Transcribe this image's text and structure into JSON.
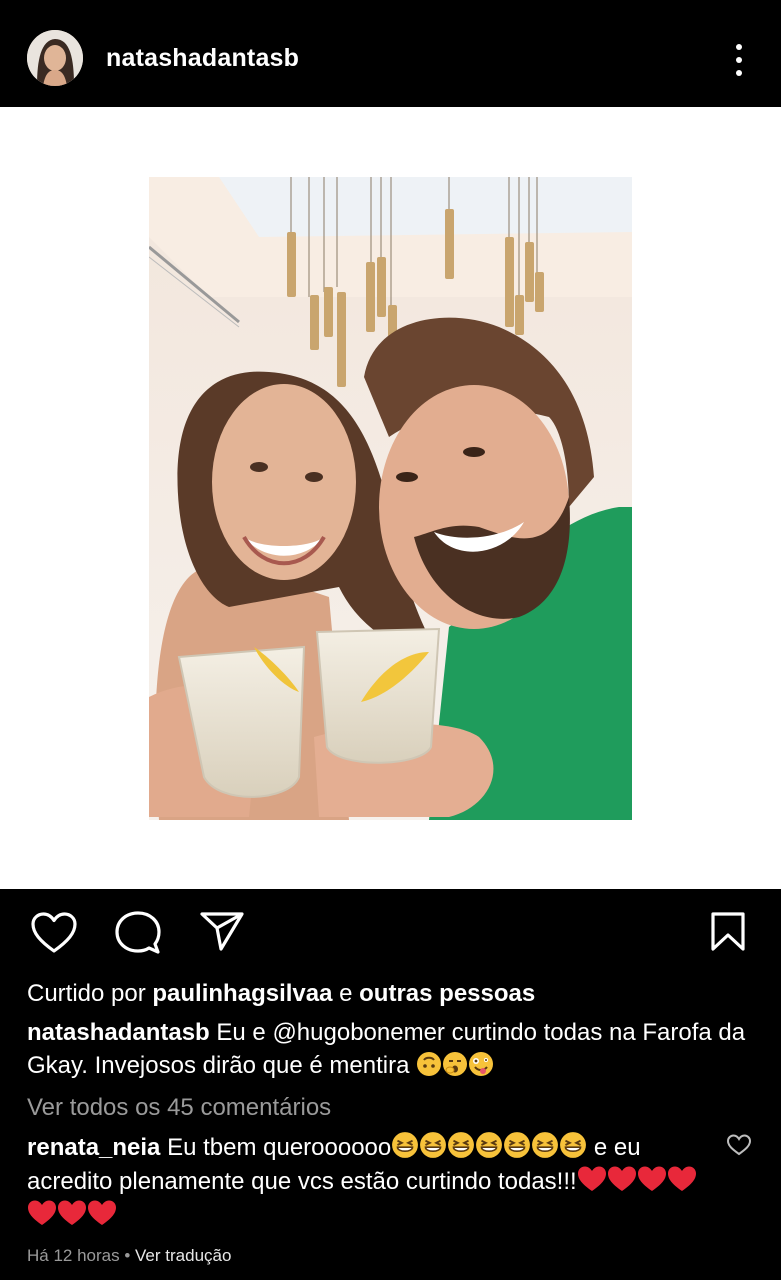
{
  "header": {
    "username": "natashadantasb"
  },
  "likes": {
    "prefix": "Curtido por ",
    "user": "paulinhagsilvaa",
    "middle": " e ",
    "others": "outras pessoas"
  },
  "caption": {
    "user": "natashadantasb",
    "text_before": " Eu e ",
    "mention": "@hugobonemer",
    "text_after": " curtindo todas na Farofa da Gkay. Invejosos dirão que é mentira "
  },
  "view_all": "Ver todos os 45 comentários",
  "comment": {
    "user": "renata_neia",
    "text_before": " Eu tbem queroooooo",
    "text_after": " e eu acredito plenamente que vcs estão curtindo todas!!!"
  },
  "meta": {
    "time": "Há 12 horas",
    "dot": " • ",
    "translate": "Ver tradução"
  },
  "colors": {
    "background": "#000000",
    "post_background": "#ffffff",
    "secondary_text": "#9a9a9a",
    "heart_emoji": "#e8283a",
    "shirt_green": "#20a060"
  },
  "icons": [
    "more-vertical-icon",
    "heart-outline-icon",
    "comment-bubble-icon",
    "send-paper-plane-icon",
    "bookmark-icon"
  ]
}
